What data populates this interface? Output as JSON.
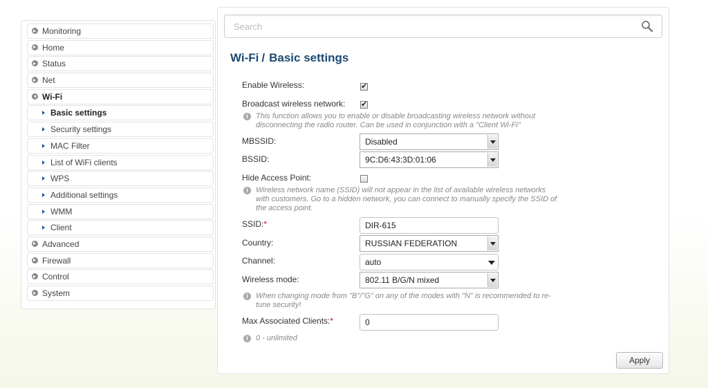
{
  "sidebar": {
    "items": [
      {
        "label": "Monitoring"
      },
      {
        "label": "Home"
      },
      {
        "label": "Status"
      },
      {
        "label": "Net"
      },
      {
        "label": "Wi-Fi"
      },
      {
        "label": "Basic settings"
      },
      {
        "label": "Security settings"
      },
      {
        "label": "MAC Filter"
      },
      {
        "label": "List of WiFi clients"
      },
      {
        "label": "WPS"
      },
      {
        "label": "Additional settings"
      },
      {
        "label": "WMM"
      },
      {
        "label": "Client"
      },
      {
        "label": "Advanced"
      },
      {
        "label": "Firewall"
      },
      {
        "label": "Control"
      },
      {
        "label": "System"
      }
    ]
  },
  "search": {
    "placeholder": "Search",
    "icon": "search-icon"
  },
  "page": {
    "section": "Wi-Fi",
    "separator": "/",
    "title": "Basic settings"
  },
  "form": {
    "enable_wireless": {
      "label": "Enable Wireless:",
      "checked": true
    },
    "broadcast": {
      "label": "Broadcast wireless network:",
      "checked": true,
      "hint_line1": "This function allows you to enable or disable broadcasting wireless network without",
      "hint_line2": "disconnecting the radio router. Can be used in conjunction with a \"Client Wi-Fi\""
    },
    "mbssid": {
      "label": "MBSSID:",
      "value": "Disabled"
    },
    "bssid": {
      "label": "BSSID:",
      "value": "9C:D6:43:3D:01:06"
    },
    "hide_ap": {
      "label": "Hide Access Point:",
      "checked": false,
      "hint_line1": "Wireless network name (SSID) will not appear in the list of available wireless networks",
      "hint_line2": "with customers. Go to a hidden network, you can connect to manually specify the SSID of",
      "hint_line3": "the access point."
    },
    "ssid": {
      "label": "SSID:",
      "required": "*",
      "value": "DIR-615"
    },
    "country": {
      "label": "Country:",
      "value": "RUSSIAN FEDERATION"
    },
    "channel": {
      "label": "Channel:",
      "value": "auto"
    },
    "wireless_mode": {
      "label": "Wireless mode:",
      "value": "802.11 B/G/N mixed",
      "hint_line1": "When changing mode from \"B\"/\"G\" on any of the modes with \"N\" is recommended to re-",
      "hint_line2": "tune security!"
    },
    "max_clients": {
      "label": "Max Associated Clients:",
      "required": "*",
      "value": "0",
      "hint": "0 - unlimited"
    }
  },
  "apply_label": "Apply",
  "colors": {
    "title": "#1c4a72",
    "required": "#d9001b",
    "subnav_arrow": "#1e5a96"
  }
}
